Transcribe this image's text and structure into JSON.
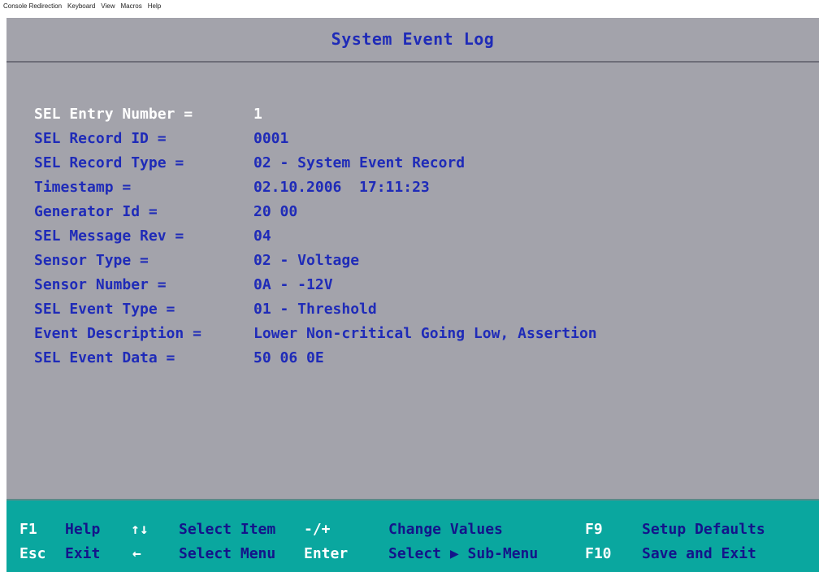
{
  "viewer_menu": [
    "Console Redirection",
    "Keyboard",
    "View",
    "Macros",
    "Help"
  ],
  "title": "System Event Log",
  "entries": [
    {
      "label": "SEL Entry Number =",
      "value": "1"
    },
    {
      "label": "SEL Record ID =",
      "value": "0001"
    },
    {
      "label": "SEL Record Type =",
      "value": "02 - System Event Record"
    },
    {
      "label": "Timestamp =",
      "value": "02.10.2006  17:11:23"
    },
    {
      "label": "Generator Id =",
      "value": "20 00"
    },
    {
      "label": "SEL Message Rev =",
      "value": "04"
    },
    {
      "label": "Sensor Type =",
      "value": "02 - Voltage"
    },
    {
      "label": "Sensor Number =",
      "value": "0A - -12V"
    },
    {
      "label": "SEL Event Type =",
      "value": "01 - Threshold"
    },
    {
      "label": "Event Description =",
      "value": "Lower Non-critical Going Low, Assertion"
    },
    {
      "label": "SEL Event Data =",
      "value": "50 06 0E"
    }
  ],
  "hotkeys": {
    "help": {
      "key": "F1",
      "action": "Help"
    },
    "select_item": {
      "key": "↑↓",
      "action": "Select Item"
    },
    "change_values": {
      "key": "-/+",
      "action": "Change Values"
    },
    "setup_defaults": {
      "key": "F9",
      "action": "Setup Defaults"
    },
    "exit": {
      "key": "Esc",
      "action": "Exit"
    },
    "select_menu": {
      "key": "←",
      "action": "Select Menu"
    },
    "sub_menu": {
      "key": "Enter",
      "action": "Select ▶ Sub-Menu"
    },
    "save_exit": {
      "key": "F10",
      "action": "Save and Exit"
    }
  },
  "colors": {
    "background": "#a3a3ab",
    "text": "#1f2bb8",
    "selected_text": "#ffffff",
    "footer": "#0aa79f"
  }
}
